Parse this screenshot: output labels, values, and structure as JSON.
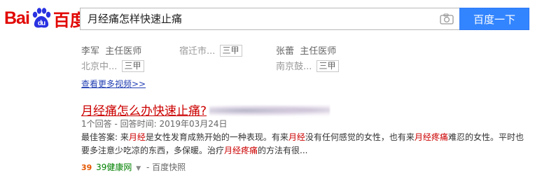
{
  "header": {
    "logo_text_left": "Bai",
    "logo_text_right": "百度",
    "logo_paw_text": "du",
    "search_value": "月经痛怎样快速止痛",
    "search_button": "百度一下",
    "camera_icon": "camera-icon"
  },
  "doctors": {
    "row1": [
      {
        "name": "李军",
        "title": "主任医师"
      },
      {
        "name": "宿迁市...",
        "title": "",
        "tag": "三甲"
      },
      {
        "name": "张蕾",
        "title": "主任医师"
      }
    ],
    "row2": [
      {
        "name": "北京中...",
        "tag": "三甲"
      },
      {
        "name": "南京鼓...",
        "tag": "三甲"
      }
    ]
  },
  "more_link": "查看更多视频>>",
  "result": {
    "title": "月经痛怎么办快速止痛?",
    "meta": "1个回答 - 回答时间: 2019年03月24日",
    "abstract_parts": {
      "p1": "最佳答案: 来",
      "p2": "月经",
      "p3": "是女性发育成熟开始的一种表现。有来",
      "p4": "月经",
      "p5": "没有任何感觉的女性，也有来",
      "p6": "月经疼痛",
      "p7": "难忍的女性。平时也要多注意少吃凉的东西，多保暖。治疗",
      "p8": "月经疼痛",
      "p9": "的方法有很..."
    },
    "site_icon": "39",
    "site_name": "39健康网",
    "separator": "-",
    "snapshot": "百度快照"
  },
  "colors": {
    "brand_red": "#e10602",
    "brand_blue": "#3385ff",
    "title_red": "#cc0000",
    "url_green": "#008000",
    "link_blue": "#2440b3"
  }
}
